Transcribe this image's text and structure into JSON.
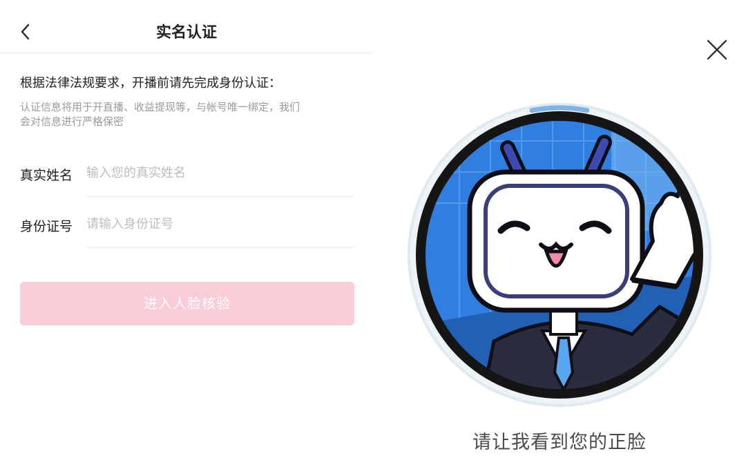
{
  "left": {
    "title": "实名认证",
    "intro": "根据法律法规要求，开播前请先完成身份认证：",
    "note_line1": "认证信息将用于开直播、收益提现等，与帐号唯一绑定，我们",
    "note_line2": "会对信息进行严格保密",
    "fields": [
      {
        "label": "真实姓名",
        "placeholder": "输入您的真实姓名",
        "value": ""
      },
      {
        "label": "身份证号",
        "placeholder": "请输入身份证号",
        "value": ""
      }
    ],
    "submit_label": "进入人脸核验",
    "icons": {
      "back": "chevron-left-icon"
    }
  },
  "right": {
    "prompt": "请让我看到您的正脸",
    "scan_progress": 0.06,
    "icons": {
      "close": "close-icon",
      "mascot": "bilibili-tv-mascot"
    }
  },
  "colors": {
    "button_disabled": "#f9ccd8",
    "progress_accent": "#7fb2e5",
    "mascot_bg": "#2f7ee0",
    "ring_outer": "#dfe9f0"
  }
}
